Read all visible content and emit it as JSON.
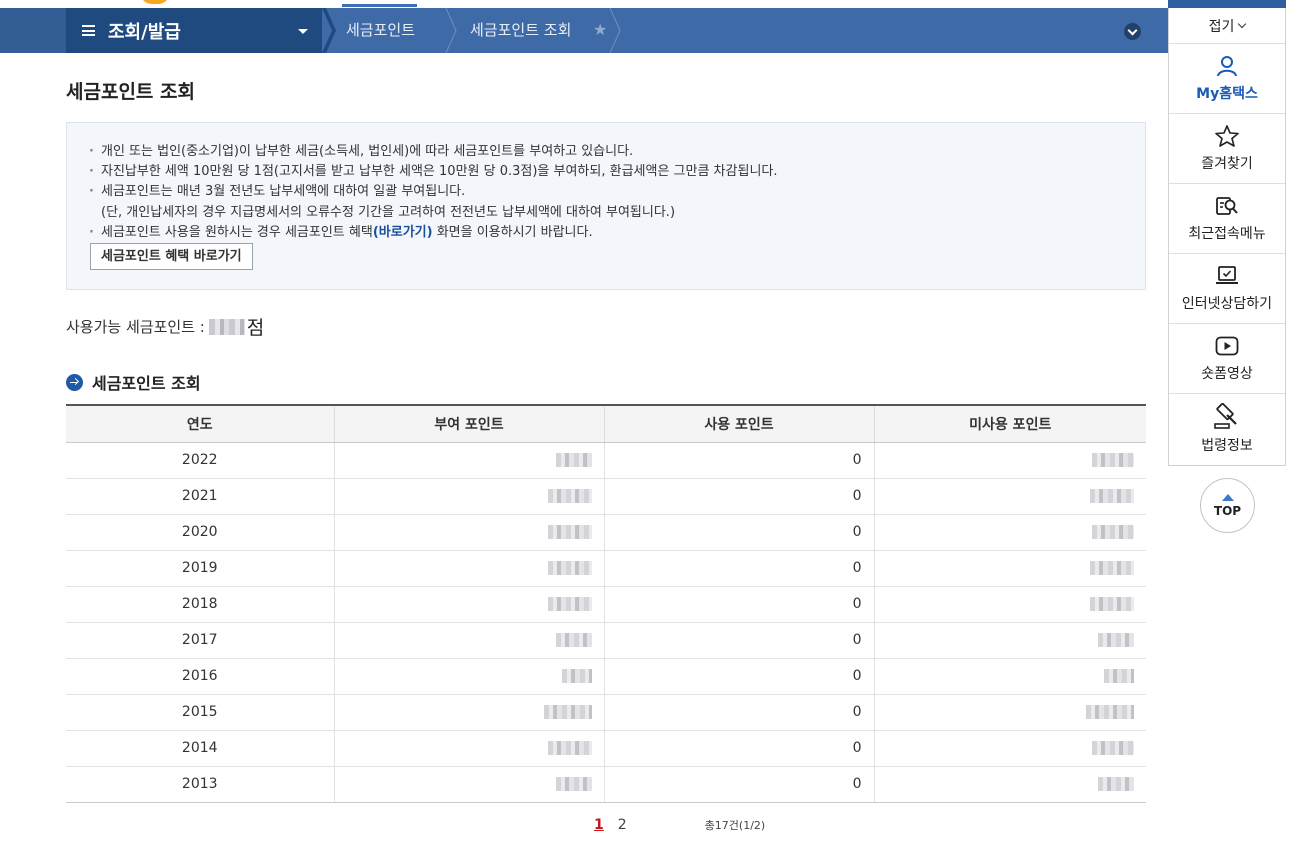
{
  "nav": {
    "menu_title": "조회/발급",
    "crumbs": [
      "세금포인트",
      "세금포인트 조회"
    ]
  },
  "page": {
    "title": "세금포인트 조회"
  },
  "info": {
    "lines": [
      "개인 또는 법인(중소기업)이 납부한 세금(소득세, 법인세)에 따라 세금포인트를 부여하고 있습니다.",
      "자진납부한 세액 10만원 당 1점(고지서를 받고 납부한 세액은 10만원 당 0.3점)을 부여하되, 환급세액은 그만큼 차감됩니다.",
      "세금포인트는 매년 3월 전년도 납부세액에 대하여 일괄 부여됩니다.",
      "(단, 개인납세자의 경우 지급명세서의 오류수정 기간을 고려하여 전전년도 납부세액에 대하여 부여됩니다.)"
    ],
    "last_line_prefix": "세금포인트 사용을 원하시는 경우 세금포인트 혜택",
    "last_line_link": "(바로가기)",
    "last_line_suffix": " 화면을 이용하시기 바랍니다.",
    "benefit_button": "세금포인트 혜택 바로가기"
  },
  "available": {
    "label": "사용가능 세금포인트 : ",
    "unit": "점"
  },
  "section": {
    "title": "세금포인트 조회"
  },
  "table": {
    "headers": [
      "연도",
      "부여 포인트",
      "사용 포인트",
      "미사용 포인트"
    ],
    "rows": [
      {
        "year": "2022",
        "used": "0"
      },
      {
        "year": "2021",
        "used": "0"
      },
      {
        "year": "2020",
        "used": "0"
      },
      {
        "year": "2019",
        "used": "0"
      },
      {
        "year": "2018",
        "used": "0"
      },
      {
        "year": "2017",
        "used": "0"
      },
      {
        "year": "2016",
        "used": "0"
      },
      {
        "year": "2015",
        "used": "0"
      },
      {
        "year": "2014",
        "used": "0"
      },
      {
        "year": "2013",
        "used": "0"
      }
    ]
  },
  "pagination": {
    "pages": [
      "1",
      "2"
    ],
    "current": "1",
    "total": "총17건(1/2)"
  },
  "quick_menu": {
    "fold": "접기",
    "items": [
      {
        "label": "My홈택스",
        "icon": "person-icon"
      },
      {
        "label": "즐겨찾기",
        "icon": "star-icon"
      },
      {
        "label": "최근접속메뉴",
        "icon": "recent-search-icon"
      },
      {
        "label": "인터넷상담하기",
        "icon": "laptop-check-icon"
      },
      {
        "label": "숏폼영상",
        "icon": "play-icon"
      },
      {
        "label": "법령정보",
        "icon": "gavel-icon"
      }
    ],
    "top": "TOP"
  },
  "colors": {
    "nav_bar": "#3e6ba8",
    "menu_box": "#1f4a80",
    "accent_blue": "#1a5bb5",
    "current_page_red": "#c4161c"
  }
}
